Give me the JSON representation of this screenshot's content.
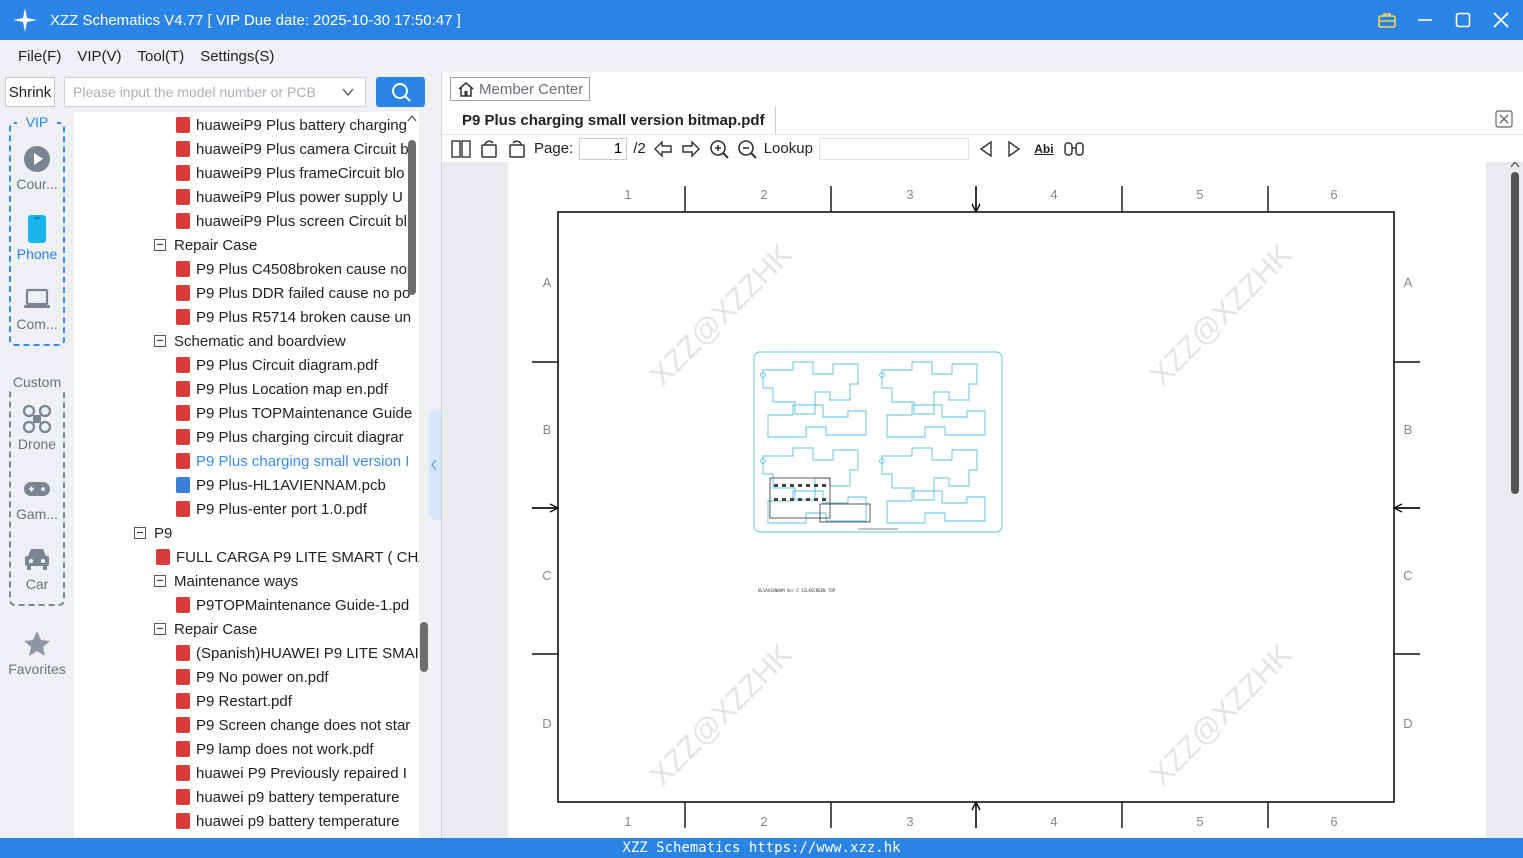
{
  "window": {
    "title": "XZZ Schematics V4.77 [ VIP Due date: 2025-10-30 17:50:47 ]",
    "accent": "#2a84e6"
  },
  "menu": [
    "File(F)",
    "VIP(V)",
    "Tool(T)",
    "Settings(S)"
  ],
  "left_toolbar": {
    "shrink_label": "Shrink",
    "search_placeholder": "Please input the model number or PCB"
  },
  "sidebar": {
    "vip_label": "VIP",
    "custom_label": "Custom",
    "categories": [
      {
        "label": "Cour...",
        "icon": "play-circle-icon"
      },
      {
        "label": "Phone",
        "icon": "phone-icon",
        "active": true
      },
      {
        "label": "Com...",
        "icon": "laptop-icon"
      },
      {
        "label": "Drone",
        "icon": "drone-icon"
      },
      {
        "label": "Gam...",
        "icon": "gamepad-icon"
      },
      {
        "label": "Car",
        "icon": "car-icon"
      }
    ],
    "favorites_label": "Favorites"
  },
  "tree": [
    {
      "label": "huaweiP9 Plus battery charging",
      "kind": "pdf",
      "level": 2
    },
    {
      "label": "huaweiP9 Plus camera Circuit b",
      "kind": "pdf",
      "level": 2
    },
    {
      "label": "huaweiP9 Plus frameCircuit blo",
      "kind": "pdf",
      "level": 2
    },
    {
      "label": "huaweiP9 Plus power supply U",
      "kind": "pdf",
      "level": 2
    },
    {
      "label": "huaweiP9 Plus screen Circuit bl",
      "kind": "pdf",
      "level": 2
    },
    {
      "label": "Repair Case",
      "kind": "folder",
      "level": 1
    },
    {
      "label": "P9 Plus C4508broken cause no",
      "kind": "pdf",
      "level": 2
    },
    {
      "label": "P9 Plus DDR failed cause no po",
      "kind": "pdf",
      "level": 2
    },
    {
      "label": "P9 Plus R5714 broken cause un",
      "kind": "pdf",
      "level": 2
    },
    {
      "label": "Schematic and boardview",
      "kind": "folder",
      "level": 1
    },
    {
      "label": "P9 Plus Circuit diagram.pdf",
      "kind": "pdf",
      "level": 2
    },
    {
      "label": "P9 Plus Location map en.pdf",
      "kind": "pdf",
      "level": 2
    },
    {
      "label": "P9 Plus TOPMaintenance Guide",
      "kind": "pdf",
      "level": 2
    },
    {
      "label": "P9 Plus charging circuit diagrar",
      "kind": "pdf",
      "level": 2
    },
    {
      "label": "P9 Plus charging small version I",
      "kind": "pdf",
      "level": 2,
      "selected": true
    },
    {
      "label": "P9 Plus-HL1AVIENNAM.pcb",
      "kind": "pcb",
      "level": 2
    },
    {
      "label": "P9 Plus-enter port 1.0.pdf",
      "kind": "pdf",
      "level": 2
    },
    {
      "label": "P9",
      "kind": "folder",
      "level": 0
    },
    {
      "label": "FULL CARGA P9 LITE SMART ( CHA",
      "kind": "pdf",
      "level": 1
    },
    {
      "label": "Maintenance ways",
      "kind": "folder",
      "level": 1
    },
    {
      "label": "P9TOPMaintenance Guide-1.pd",
      "kind": "pdf",
      "level": 2
    },
    {
      "label": "Repair Case",
      "kind": "folder",
      "level": 1
    },
    {
      "label": "(Spanish)HUAWEI P9 LITE SMAI",
      "kind": "pdf",
      "level": 2
    },
    {
      "label": "P9 No power on.pdf",
      "kind": "pdf",
      "level": 2
    },
    {
      "label": "P9 Restart.pdf",
      "kind": "pdf",
      "level": 2
    },
    {
      "label": "P9 Screen change does not star",
      "kind": "pdf",
      "level": 2
    },
    {
      "label": "P9 lamp does not work.pdf",
      "kind": "pdf",
      "level": 2
    },
    {
      "label": "huawei P9 Previously repaired I",
      "kind": "pdf",
      "level": 2
    },
    {
      "label": "huawei p9 battery temperature",
      "kind": "pdf",
      "level": 2
    },
    {
      "label": "huawei p9 battery temperature",
      "kind": "pdf",
      "level": 2
    }
  ],
  "viewer": {
    "member_center_label": "Member Center",
    "tab_title": "P9 Plus charging small version bitmap.pdf",
    "page_label": "Page:",
    "page_current": "1",
    "page_total": "/2",
    "lookup_label": "Lookup",
    "abi_label": "Abi"
  },
  "drawing": {
    "col_labels": [
      "1",
      "2",
      "3",
      "4",
      "5",
      "6"
    ],
    "row_labels": [
      "A",
      "B",
      "C",
      "D"
    ],
    "watermark": "XZZ@XZZHK",
    "board_caption": "HL1AVIENNAM Ver.C SILKSCREEN TOP",
    "board_color": "#5bc0de"
  },
  "statusbar": {
    "text": "XZZ Schematics https://www.xzz.hk"
  }
}
